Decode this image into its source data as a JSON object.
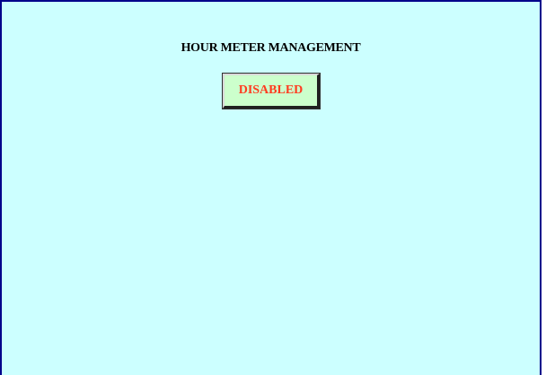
{
  "page": {
    "title": "HOUR METER MANAGEMENT"
  },
  "status_button": {
    "label": "DISABLED",
    "background": "#ccffcc",
    "text_color": "#ff3b1f"
  },
  "colors": {
    "background": "#ccffff",
    "border": "#00008b"
  }
}
